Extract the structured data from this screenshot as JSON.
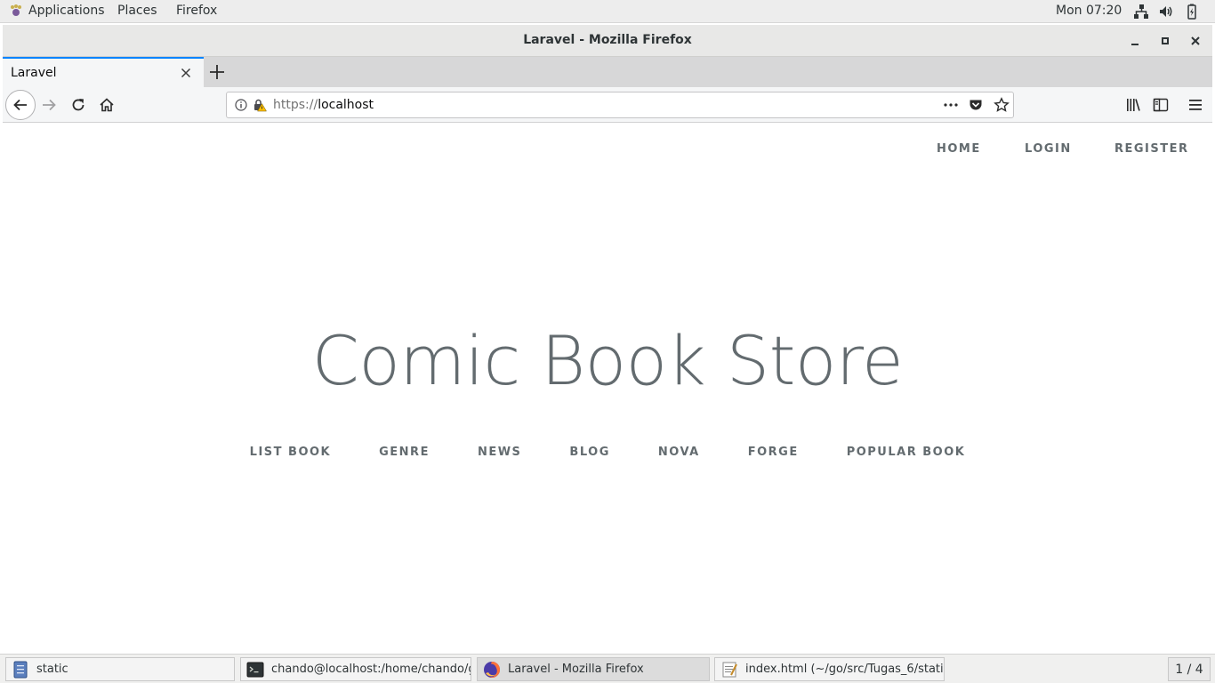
{
  "topbar": {
    "applications": "Applications",
    "places": "Places",
    "firefox": "Firefox",
    "clock": "Mon 07:20"
  },
  "window": {
    "title": "Laravel - Mozilla Firefox"
  },
  "tabs": [
    {
      "label": "Laravel"
    }
  ],
  "urlbar": {
    "scheme": "https://",
    "host": "localhost"
  },
  "page": {
    "top_links": [
      "HOME",
      "LOGIN",
      "REGISTER"
    ],
    "title": "Comic Book Store",
    "links": [
      "LIST BOOK",
      "GENRE",
      "NEWS",
      "BLOG",
      "NOVA",
      "FORGE",
      "POPULAR BOOK"
    ]
  },
  "taskbar": {
    "tasks": [
      {
        "label": "static",
        "icon": "file-manager-icon"
      },
      {
        "label": "chando@localhost:/home/chando/g...",
        "icon": "terminal-icon"
      },
      {
        "label": "Laravel - Mozilla Firefox",
        "icon": "firefox-icon"
      },
      {
        "label": "index.html (~/go/src/Tugas_6/static...",
        "icon": "text-editor-icon"
      }
    ],
    "workspace": "1 / 4"
  },
  "colors": {
    "accent": "#0a84ff",
    "page_text": "#636b6f"
  }
}
